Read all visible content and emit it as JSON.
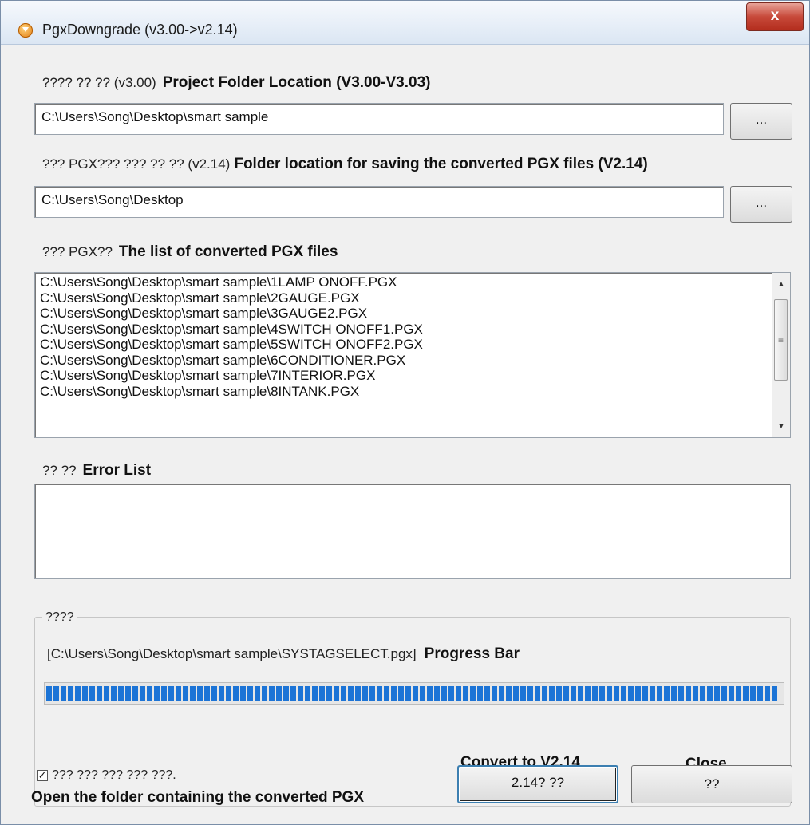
{
  "window": {
    "title": "PgxDowngrade (v3.00->v2.14)",
    "close_glyph": "x"
  },
  "project_folder": {
    "label_korean": "???? ?? ?? (v3.00)",
    "label_english": "Project Folder Location (V3.00-V3.03)",
    "value": "C:\\Users\\Song\\Desktop\\smart sample",
    "browse_label": "..."
  },
  "save_folder": {
    "label_korean": "??? PGX??? ??? ?? ?? (v2.14)",
    "label_english": "Folder location for saving the converted PGX files (V2.14)",
    "value": "C:\\Users\\Song\\Desktop",
    "browse_label": "..."
  },
  "converted_list": {
    "label_korean": "??? PGX??",
    "label_english": "The list of converted PGX files",
    "items": [
      "C:\\Users\\Song\\Desktop\\smart sample\\1LAMP ONOFF.PGX",
      "C:\\Users\\Song\\Desktop\\smart sample\\2GAUGE.PGX",
      "C:\\Users\\Song\\Desktop\\smart sample\\3GAUGE2.PGX",
      "C:\\Users\\Song\\Desktop\\smart sample\\4SWITCH ONOFF1.PGX",
      "C:\\Users\\Song\\Desktop\\smart sample\\5SWITCH ONOFF2.PGX",
      "C:\\Users\\Song\\Desktop\\smart sample\\6CONDITIONER.PGX",
      "C:\\Users\\Song\\Desktop\\smart sample\\7INTERIOR.PGX",
      "C:\\Users\\Song\\Desktop\\smart sample\\8INTANK.PGX"
    ]
  },
  "error_list": {
    "label_korean": "?? ??",
    "label_english": "Error List"
  },
  "progress": {
    "group_title": "????",
    "current_file": "[C:\\Users\\Song\\Desktop\\smart sample\\SYSTAGSELECT.pgx]",
    "label_english": "Progress Bar",
    "fraction": 0.995
  },
  "annotations": {
    "convert": "Convert to V2.14",
    "close": "Close"
  },
  "open_folder": {
    "checked": true,
    "check_glyph": "✓",
    "label_korean": "??? ??? ??? ??? ???.",
    "label_english": "Open the folder containing the converted PGX"
  },
  "buttons": {
    "convert_label": "2.14? ??",
    "close_label": "??"
  }
}
